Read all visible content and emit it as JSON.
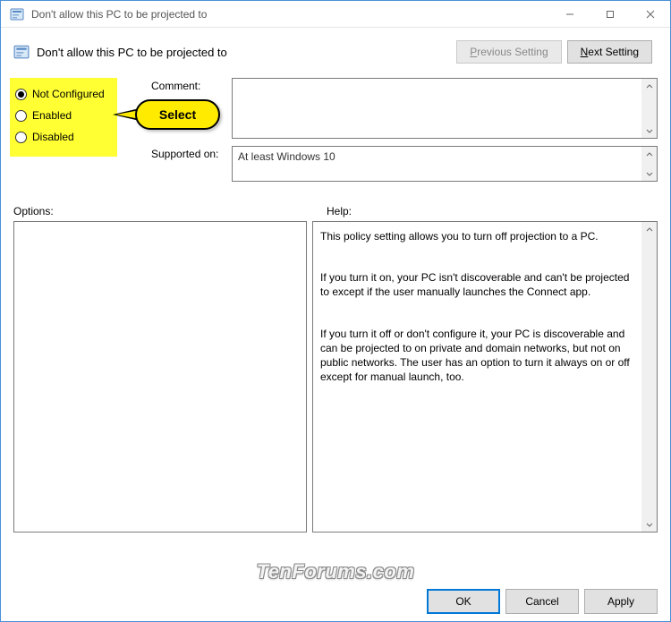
{
  "window": {
    "title": "Don't allow this PC to be projected to"
  },
  "header": {
    "policy_title": "Don't allow this PC to be projected to",
    "prev_label": "Previous Setting",
    "next_label": "Next Setting"
  },
  "radios": {
    "not_configured": "Not Configured",
    "enabled": "Enabled",
    "disabled": "Disabled",
    "selected": "not_configured"
  },
  "callout": {
    "text": "Select"
  },
  "fields": {
    "comment_label": "Comment:",
    "comment_value": "",
    "supported_label": "Supported on:",
    "supported_value": "At least Windows 10"
  },
  "labels": {
    "options": "Options:",
    "help": "Help:"
  },
  "help": {
    "p1": "This policy setting allows you to turn off projection to a PC.",
    "p2": "If you turn it on, your PC isn't discoverable and can't be projected to except if the user manually launches the Connect app.",
    "p3": "If you turn it off or don't configure it, your PC is discoverable and can be projected to on private and domain networks, but not on public networks. The user has an option to turn it always on or off except for manual launch, too."
  },
  "footer": {
    "ok": "OK",
    "cancel": "Cancel",
    "apply": "Apply"
  },
  "watermark": "TenForums.com"
}
